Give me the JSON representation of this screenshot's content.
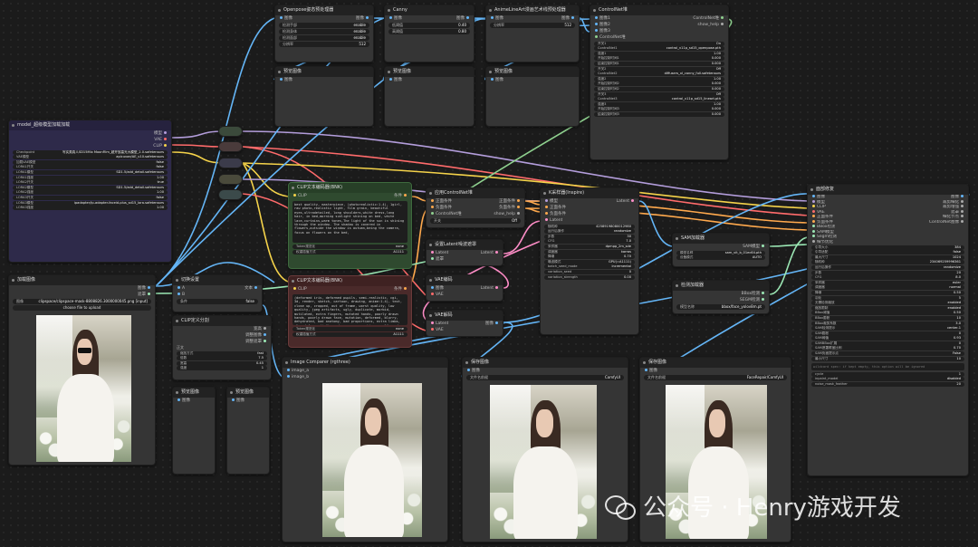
{
  "colors": {
    "model": "#b39ddb",
    "clip": "#f5d34a",
    "vae": "#ff6b6b",
    "conditioning": "#ffa94d",
    "latent": "#ff8ec8",
    "image": "#64b5f6",
    "control": "#8fd18f",
    "sam": "#9be7b4",
    "green_node": "#2f4a2f",
    "red_node": "#4a2a2a",
    "purple_node": "#2e2a4a"
  },
  "nodes": {
    "openpose": {
      "title": "Openpose姿态预处理器",
      "io_in": "图像",
      "io_out": "图像",
      "widgets": [
        [
          "检测手部",
          "enable"
        ],
        [
          "检测身体",
          "enable"
        ],
        [
          "检测面部",
          "enable"
        ],
        [
          "分辨率",
          "512"
        ]
      ]
    },
    "canny": {
      "title": "Canny",
      "io_in": "图像",
      "io_out": "图像",
      "widgets": [
        [
          "低阈值",
          "0.40"
        ],
        [
          "高阈值",
          "0.80"
        ]
      ]
    },
    "anime_lineart": {
      "title": "AnimeLineArt漫画艺术线预处理器",
      "io_in": "图像",
      "io_out": "图像",
      "widgets": [
        [
          "分辨率",
          "512"
        ]
      ]
    },
    "preview1": {
      "title": "预览图像",
      "io_in": "图像"
    },
    "preview2": {
      "title": "预览图像",
      "io_in": "图像"
    },
    "preview3": {
      "title": "预览图像",
      "io_in": "图像"
    },
    "controlnet_stack": {
      "title": "ControlNet堆",
      "io_in1": "图像1",
      "io_in2": "图像2",
      "io_in3": "图像3",
      "io_out1": "ControlNet堆",
      "io_out2": "show_help",
      "sub": "ControlNet堆",
      "widgets": [
        [
          "开关1",
          "On"
        ],
        [
          "ControlNet1",
          "control_v11p_sd15_openpose.pth"
        ],
        [
          "强度1",
          "1.00"
        ],
        [
          "开始控制时间1",
          "0.000"
        ],
        [
          "结束控制时间1",
          "0.000"
        ],
        [
          "开关2",
          "Off"
        ],
        [
          "ControlNet2",
          "diffusers_xl_canny_full.safetensors"
        ],
        [
          "强度2",
          "1.00"
        ],
        [
          "开始控制时间2",
          "0.000"
        ],
        [
          "结束控制时间2",
          "0.000"
        ],
        [
          "开关3",
          "Off"
        ],
        [
          "ControlNet3",
          "control_v11p_sd15_lineart.pth"
        ],
        [
          "强度3",
          "1.00"
        ],
        [
          "开始控制时间3",
          "0.000"
        ],
        [
          "结束控制时间3",
          "0.000"
        ]
      ]
    },
    "model_loader": {
      "title": "model_超级模型加载加载",
      "outputs": [
        "模型",
        "VAE",
        "CLIP"
      ],
      "widgets": [
        [
          "Checkpoint",
          "写实类真人SD15Mix MoonFilm_超开放高光大模型_2.0.safetensors"
        ],
        [
          "VAE模型",
          "apicuvae/AE_v10.safetensors"
        ],
        [
          "加载VAE模型",
          "false"
        ],
        [
          "LORA1开关",
          "false"
        ],
        [
          "LORA1模型",
          "SD1.5/add_detail.safetensors"
        ],
        [
          "LORA1强度",
          "1.00"
        ],
        [
          "LORA2开关",
          "true"
        ],
        [
          "LORA2模型",
          "SD1.5/add_detail.safetensors"
        ],
        [
          "LORA2强度",
          "1.00"
        ],
        [
          "LORA3开关",
          "false"
        ],
        [
          "LORA3模型",
          "ipadapter/ip-adapter-faceid-plus_sd15_lora.safetensors"
        ],
        [
          "LORA3强度",
          "1.00"
        ]
      ]
    },
    "load_image": {
      "title": "加载图像",
      "outputs": [
        "图像",
        "遮罩"
      ],
      "widget": [
        "图像",
        "clipspace/clipspace-mask-8808826.3000000045.png [input]"
      ],
      "button": "choose file to upload"
    },
    "text_proc": {
      "title": "切换设置",
      "in": "A",
      "in2": "B",
      "out": "文本",
      "widget": [
        "条件",
        "false"
      ]
    },
    "clip_split": {
      "title": "CLIP定义分割",
      "outputs": [
        "宽高",
        "调整图像",
        "调整遮罩"
      ],
      "widgets": [
        [
          "缩放方式",
          "fast"
        ],
        [
          "倍数",
          "7.5"
        ],
        [
          "宽高",
          "0.45"
        ],
        [
          "强度",
          "1"
        ]
      ],
      "label": "正文"
    },
    "small_preview1": {
      "title": "预览图像",
      "io_in": "图像"
    },
    "small_preview2": {
      "title": "预览图像",
      "io_in": "图像"
    },
    "clip_pos": {
      "title": "CLIP文本编码器(BNK)",
      "io_in": "CLIP",
      "io_out": "条件",
      "text": "best quality, masterpiece, (photorealistic:1.4), 1girl, raw photo,realistic light, film grain, beautiful eyes,ultradetailed, long shoulders,white dress,long hair, in bed,morning sunlight shining on bed, white lace,curtains,warm tones,The light of the sun is shining through the window. The shadow is covered in flowers,outside the window is autumn,being the camera, focus on flowers on the bed,",
      "widgets": [
        [
          "Token规范化",
          "none"
        ],
        [
          "权重插值方式",
          "A1111"
        ]
      ]
    },
    "clip_neg": {
      "title": "CLIP文本编码器(BNK)",
      "io_in": "CLIP",
      "io_out": "条件",
      "text": "(deformed iris, deformed pupils, semi-realistic, cgi, 3d, render, sketch, cartoon, drawing, anime:1.4), text, close up, cropped, out of frame, worst quality, low quality, jpeg artifacts, ugly, duplicate, morbid, mutilated, extra fingers, mutated hands, poorly drawn hands, poorly drawn face, mutation, deformed, blurry, dehydrated, bad anatomy, bad proportions, extra limbs, cloned face, disfigured, gross proportions, malformed limbs, missing arms, missing legs, extra arms, extra legs, fused fingers, too many fingers, long neck",
      "widgets": [
        [
          "Token规范化",
          "none"
        ],
        [
          "权重插值方式",
          "A1111"
        ]
      ]
    },
    "apply_controlnet": {
      "title": "应用ControlNet堆",
      "inputs": [
        "正面条件",
        "负面条件",
        "ControlNet堆"
      ],
      "outputs": [
        "正面条件",
        "负面条件",
        "show_help"
      ],
      "widget": [
        "开关",
        "Off"
      ]
    },
    "empty_latent": {
      "title": "设置Latent噪波遮罩",
      "inputs": [
        "Latent",
        "遮罩"
      ],
      "out": "Latent"
    },
    "vae_encode": {
      "title": "VAE编码",
      "inputs": [
        "图像",
        "VAE"
      ],
      "out": "Latent"
    },
    "vae_decode": {
      "title": "VAE解码",
      "inputs": [
        "Latent",
        "VAE"
      ],
      "out": "图像"
    },
    "ksampler": {
      "title": "K采样器(Inspire)",
      "inputs": [
        "模型",
        "正面条件",
        "负面条件",
        "Latent"
      ],
      "out": "Latent",
      "widgets": [
        [
          "随机种",
          "42589198080012980"
        ],
        [
          "运行后操作",
          "randomize"
        ],
        [
          "步数",
          "30"
        ],
        [
          "CFG",
          "7.0"
        ],
        [
          "采样器",
          "dpmpp_2m_sde"
        ],
        [
          "调度器",
          "karras"
        ],
        [
          "降噪",
          "0.70"
        ],
        [
          "噪波模式",
          "GPU(=A1111)"
        ],
        [
          "batch_seed_mode",
          "incremental"
        ],
        [
          "variation_seed",
          "0"
        ],
        [
          "variation_strength",
          "0.00"
        ]
      ]
    },
    "sam_loader": {
      "title": "SAM加载器",
      "out": "SAM模型",
      "widgets": [
        [
          "模型名称",
          "sam_vit_b_01ec64.pth"
        ],
        [
          "设备模式",
          "AUTO"
        ]
      ]
    },
    "detector_loader": {
      "title": "检测加载器",
      "outputs": [
        "BBox检测",
        "SEGM检测"
      ],
      "widget": [
        "模型名称",
        "bbox/face_yolov8m.pt"
      ]
    },
    "face_detailer": {
      "title": "面部修复",
      "inputs": [
        "图像",
        "模型",
        "CLIP",
        "VAE",
        "正面条件",
        "负面条件",
        "BBox检测",
        "SAM模型",
        "Segm检测",
        "细节优化"
      ],
      "outputs": [
        "图像",
        "裁剪细化",
        "裁剪增强",
        "遮罩",
        "细化节点",
        "ControlNet图像"
      ],
      "widgets": [
        [
          "引导大小",
          "384"
        ],
        [
          "引导适配",
          "false"
        ],
        [
          "最大尺寸",
          "1024"
        ],
        [
          "随机种",
          "234069259996361"
        ],
        [
          "运行后操作",
          "randomize"
        ],
        [
          "步数",
          "20"
        ],
        [
          "CFG",
          "8.0"
        ],
        [
          "采样器",
          "euler"
        ],
        [
          "调度器",
          "normal"
        ],
        [
          "降噪",
          "0.50"
        ],
        [
          "羽化",
          "5"
        ],
        [
          "无需检测缩放",
          "enabled"
        ],
        [
          "缩放限制",
          "enabled"
        ],
        [
          "BBox阈值",
          "0.50"
        ],
        [
          "BBox膨胀",
          "10"
        ],
        [
          "BBox裁剪系数",
          "3.0"
        ],
        [
          "SAM检测提示",
          "center-1"
        ],
        [
          "SAM膨胀",
          "0"
        ],
        [
          "SAM阈值",
          "0.93"
        ],
        [
          "SAMBBox扩展",
          "0"
        ],
        [
          "SAM遮罩覆盖比例",
          "0.70"
        ],
        [
          "SAM负面提示点",
          "False"
        ],
        [
          "最小尺寸",
          "10"
        ],
        [
          "cycle",
          "1"
        ],
        [
          "inpaint_model",
          "disabled"
        ],
        [
          "noise_mask_feather",
          "20"
        ]
      ],
      "wildcard": "wildcard spec: if kept empty, this option will be ignored"
    },
    "image_compare": {
      "title": "Image Comparer (rgthree)",
      "inputs": [
        "image_a",
        "image_b"
      ]
    },
    "save1": {
      "title": "保存图像",
      "io_in": "图像",
      "widget": [
        "文件名前缀",
        "ComfyUI"
      ]
    },
    "save2": {
      "title": "保存图像",
      "io_in": "图像",
      "widget": [
        "文件名前缀",
        "FaceRepair/ComfyUI"
      ]
    }
  },
  "watermark": "公众号 · Henry游戏开发"
}
